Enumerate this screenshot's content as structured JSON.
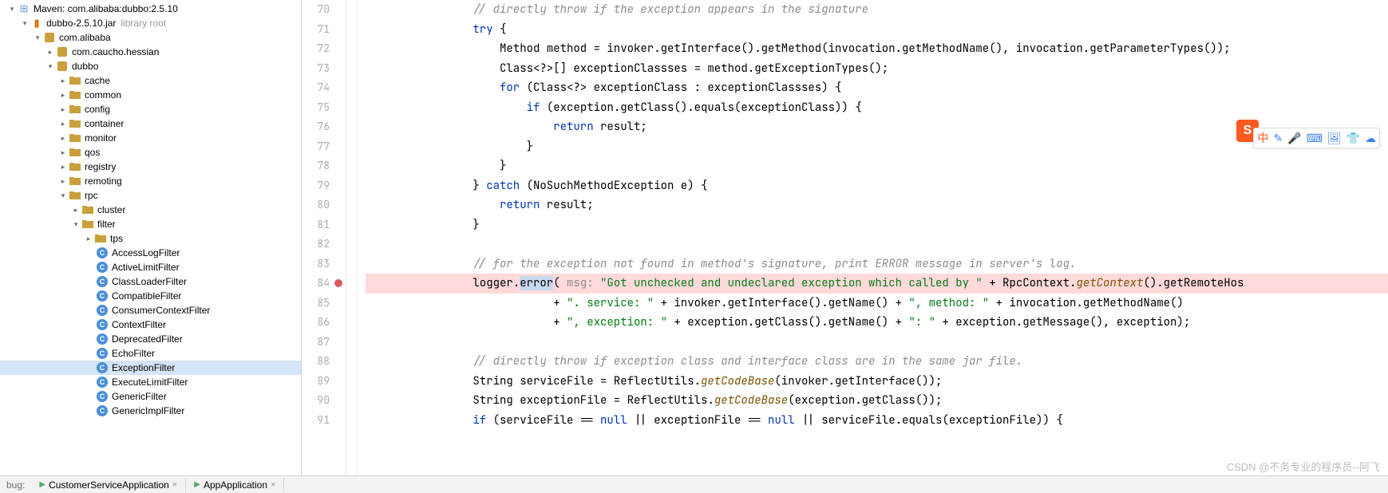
{
  "tree": {
    "maven": "Maven: com.alibaba:dubbo:2.5.10",
    "jar": "dubbo-2.5.10.jar",
    "jar_hint": "library root",
    "pkg_root": "com.alibaba",
    "hessian": "com.caucho.hessian",
    "dubbo_pkg": "dubbo",
    "folders": [
      "cache",
      "common",
      "config",
      "container",
      "monitor",
      "qos",
      "registry",
      "remoting",
      "rpc"
    ],
    "rpc_sub": [
      "cluster",
      "filter"
    ],
    "tps": "tps",
    "classes": [
      "AccessLogFilter",
      "ActiveLimitFilter",
      "ClassLoaderFilter",
      "CompatibleFilter",
      "ConsumerContextFilter",
      "ContextFilter",
      "DeprecatedFilter",
      "EchoFilter",
      "ExceptionFilter",
      "ExecuteLimitFilter",
      "GenericFilter",
      "GenericImplFilter"
    ]
  },
  "code": {
    "start": 70,
    "bp_line": 84,
    "lines": [
      {
        "t": "cmt",
        "s": "// directly throw if the exception appears in the signature",
        "i": 4
      },
      {
        "t": "",
        "s": "<kw>try</kw> {",
        "i": 4
      },
      {
        "t": "",
        "s": "Method method = invoker.getInterface().getMethod(invocation.getMethodName(), invocation.getParameterTypes());",
        "i": 5
      },
      {
        "t": "",
        "s": "Class&lt;?&gt;[] exceptionClassses = method.getExceptionTypes();",
        "i": 5
      },
      {
        "t": "",
        "s": "<kw>for</kw> (Class&lt;?&gt; exceptionClass : exceptionClassses) {",
        "i": 5
      },
      {
        "t": "",
        "s": "<kw>if</kw> (exception.getClass().equals(exceptionClass)) {",
        "i": 6
      },
      {
        "t": "",
        "s": "<kw>return</kw> result;",
        "i": 7
      },
      {
        "t": "",
        "s": "}",
        "i": 6
      },
      {
        "t": "",
        "s": "}",
        "i": 5
      },
      {
        "t": "",
        "s": "} <kw>catch</kw> (NoSuchMethodException e) {",
        "i": 4
      },
      {
        "t": "",
        "s": "<kw>return</kw> result;",
        "i": 5
      },
      {
        "t": "",
        "s": "}",
        "i": 4
      },
      {
        "t": "",
        "s": "",
        "i": 0
      },
      {
        "t": "cmt",
        "s": "// for the exception not found in method's signature, print ERROR message in server's log.",
        "i": 4
      },
      {
        "t": "bp",
        "s": "logger.<hl>error</hl>( <param>msg:</param> <str>\"Got unchecked and undeclared exception which called by \"</str> + RpcContext.<mth-s>getContext</mth-s>().getRemoteHos",
        "i": 4
      },
      {
        "t": "",
        "s": "+ <str>\". service: \"</str> + invoker.getInterface().getName() + <str>\", method: \"</str> + invocation.getMethodName()",
        "i": 7
      },
      {
        "t": "",
        "s": "+ <str>\", exception: \"</str> + exception.getClass().getName() + <str>\": \"</str> + exception.getMessage(), exception);",
        "i": 7
      },
      {
        "t": "",
        "s": "",
        "i": 0
      },
      {
        "t": "cmt",
        "s": "// directly throw if exception class and interface class are in the same jar file.",
        "i": 4
      },
      {
        "t": "",
        "s": "String serviceFile = ReflectUtils.<mth-s>getCodeBase</mth-s>(invoker.getInterface());",
        "i": 4
      },
      {
        "t": "",
        "s": "String exceptionFile = ReflectUtils.<mth-s>getCodeBase</mth-s>(exception.getClass());",
        "i": 4
      },
      {
        "t": "",
        "s": "<kw>if</kw> (serviceFile == <kw>null</kw> || exceptionFile == <kw>null</kw> || serviceFile.equals(exceptionFile)) {",
        "i": 4
      }
    ]
  },
  "bottom": {
    "label": "bug:",
    "tabs": [
      "CustomerServiceApplication",
      "AppApplication"
    ]
  },
  "watermark": "CSDN @不务专业的程序员--阿飞",
  "float_icons": [
    "中",
    "✎",
    "🎤",
    "⌨",
    "🖼",
    "👕",
    "☁"
  ]
}
